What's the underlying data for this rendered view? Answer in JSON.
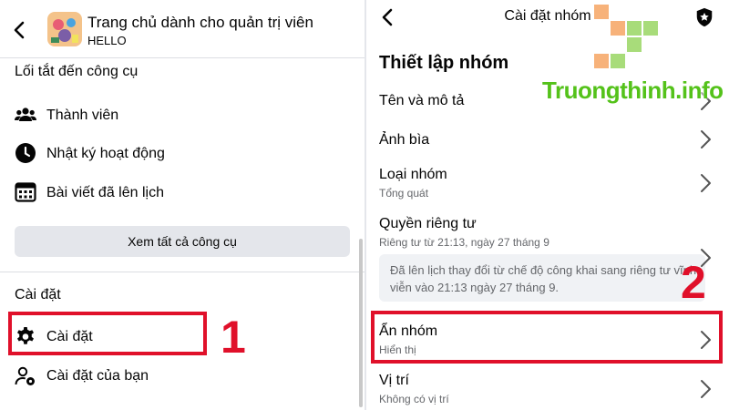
{
  "left": {
    "group_title": "Trang chủ dành cho quản trị viên",
    "group_subtitle": "HELLO",
    "tools_section": {
      "title": "Lối tắt đến công cụ",
      "items": [
        {
          "label": "Thành viên",
          "icon": "members-icon"
        },
        {
          "label": "Nhật ký hoạt động",
          "icon": "clock-icon"
        },
        {
          "label": "Bài viết đã lên lịch",
          "icon": "calendar-icon"
        }
      ],
      "see_all_label": "Xem tất cả công cụ"
    },
    "settings_section": {
      "title": "Cài đặt",
      "items": [
        {
          "label": "Cài đặt",
          "icon": "gear-icon"
        },
        {
          "label": "Cài đặt của bạn",
          "icon": "user-gear-icon"
        }
      ]
    },
    "step_label": "1"
  },
  "right": {
    "title": "Cài đặt nhóm",
    "heading": "Thiết lập nhóm",
    "items": [
      {
        "label": "Tên và mô tả"
      },
      {
        "label": "Ảnh bìa"
      },
      {
        "label": "Loại nhóm",
        "sub": "Tổng quát"
      },
      {
        "label": "Quyền riêng tư",
        "sub": "Riêng tư từ 21:13, ngày 27 tháng 9"
      },
      {
        "label": "Ẩn nhóm",
        "sub": "Hiển thị"
      },
      {
        "label": "Vị trí",
        "sub": "Không có vị trí"
      }
    ],
    "privacy_notice": "Đã lên lịch thay đổi từ chế độ công khai sang riêng tư vĩnh viễn vào 21:13 ngày 27 tháng 9.",
    "step_label": "2"
  },
  "watermark": "Truongthinh.info",
  "colors": {
    "highlight_red": "#e0102a",
    "watermark_green": "#54c21a",
    "button_gray": "#e4e6eb",
    "secondary_text": "#65676b"
  }
}
